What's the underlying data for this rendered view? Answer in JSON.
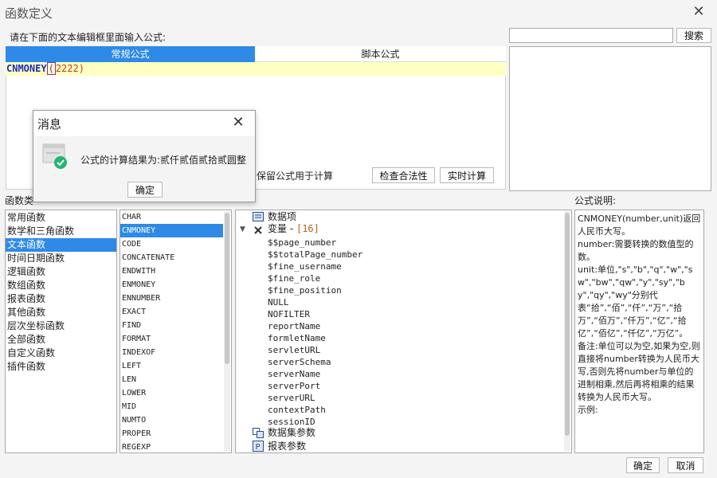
{
  "window": {
    "title": "函数定义",
    "close_glyph": "✕"
  },
  "search": {
    "value": "",
    "button_label": "搜索"
  },
  "prompt_label": "请在下面的文本编辑框里面输入公式:",
  "formula_tabs": [
    {
      "label": "常规公式",
      "active": true
    },
    {
      "label": "脚本公式",
      "active": false
    }
  ],
  "formula": {
    "function_name": "CNMONEY",
    "open_paren": "(",
    "argument": "2222",
    "close_paren": ")"
  },
  "options": {
    "keep_formula_label": "保留公式用于计算",
    "check_button": "检查合法性",
    "calc_button": "实时计算"
  },
  "section_labels": {
    "categories": "函数类",
    "description": "公式说明:"
  },
  "categories": [
    "常用函数",
    "数学和三角函数",
    "文本函数",
    "时间日期函数",
    "逻辑函数",
    "数组函数",
    "报表函数",
    "其他函数",
    "层次坐标函数",
    "全部函数",
    "自定义函数",
    "插件函数"
  ],
  "selected_category": "文本函数",
  "functions": [
    "CHAR",
    "CNMONEY",
    "CODE",
    "CONCATENATE",
    "ENDWITH",
    "ENMONEY",
    "ENNUMBER",
    "EXACT",
    "FIND",
    "FORMAT",
    "INDEXOF",
    "LEFT",
    "LEN",
    "LOWER",
    "MID",
    "NUMTO",
    "PROPER",
    "REGEXP"
  ],
  "selected_function": "CNMONEY",
  "tree": {
    "data_items": "数据项",
    "variables_label": "变量 - ",
    "variables_count": "[16]",
    "variables": [
      "$$page_number",
      "$$totalPage_number",
      "$fine_username",
      "$fine_role",
      "$fine_position",
      "NULL",
      "NOFILTER",
      "reportName",
      "formletName",
      "servletURL",
      "serverSchema",
      "serverName",
      "serverPort",
      "serverURL",
      "contextPath",
      "sessionID"
    ],
    "dataset_params": "数据集参数",
    "report_params": "报表参数"
  },
  "description": {
    "lines": [
      "CNMONEY(number,unit)返回人民币大写。",
      "number:需要转换的数值型的数。",
      "unit:单位,\"s\",\"b\",\"q\",\"w\",\"sw\",\"bw\",\"qw\",\"y\",\"sy\",\"by\",\"qy\",\"wy\"分别代表“拾”,“佰”,“仟”,“万”,“拾万”,“佰万”,“仟万”,“亿”,“拾亿”,“佰亿”,“仟亿”,“万亿”。",
      "备注:单位可以为空,如果为空,则直接将number转换为人民币大写,否则先将number与单位的进制相乘,然后再将相乘的结果转换为人民币大写。",
      "示例:"
    ]
  },
  "footer": {
    "ok": "确定",
    "cancel": "取消"
  },
  "dialog": {
    "title": "消息",
    "close_glyph": "✕",
    "message": "公式的计算结果为:贰仟贰佰贰拾贰圆整",
    "ok": "确定"
  },
  "colors": {
    "accent": "#2e8ae6",
    "formula_bg": "#ffffc2",
    "success": "#22b573"
  }
}
